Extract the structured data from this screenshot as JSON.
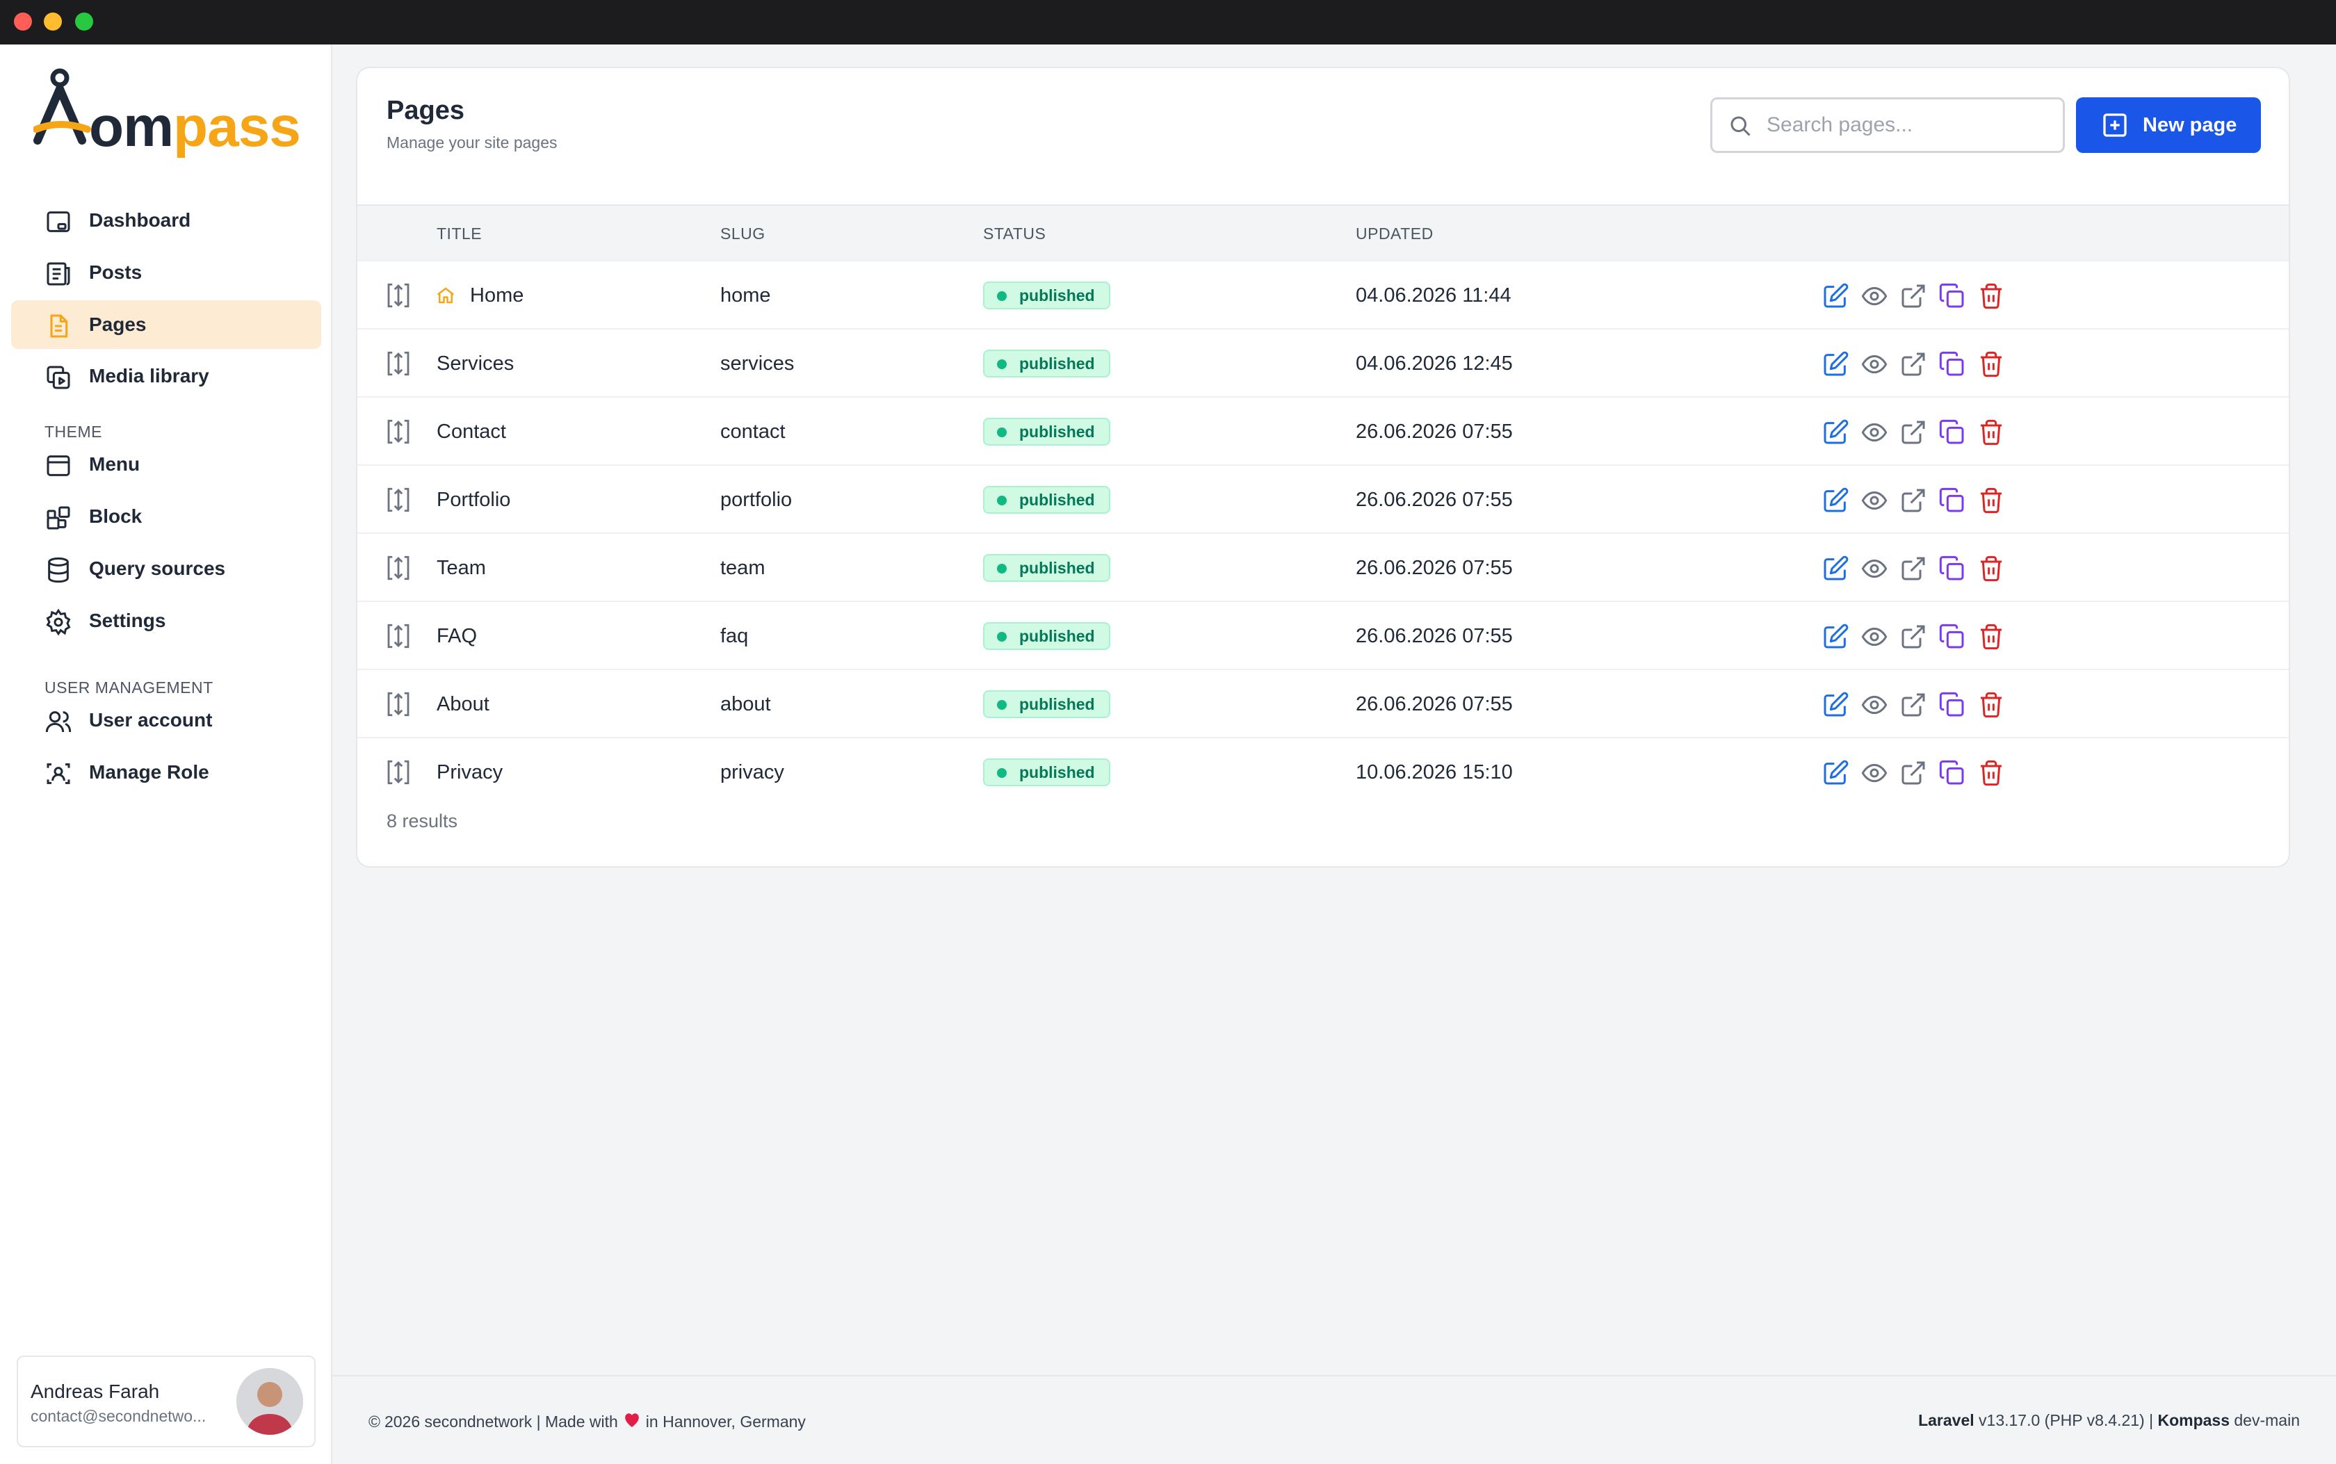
{
  "window": {
    "controls": [
      "close",
      "minimize",
      "maximize"
    ]
  },
  "brand": {
    "logo_k": "K",
    "logo_om": "om",
    "logo_pass": "pass",
    "accent": "#f5a516"
  },
  "sidebar": {
    "main_items": [
      {
        "label": "Dashboard",
        "icon": "dashboard-icon"
      },
      {
        "label": "Posts",
        "icon": "posts-icon"
      },
      {
        "label": "Pages",
        "icon": "pages-icon",
        "active": true
      },
      {
        "label": "Media library",
        "icon": "media-icon"
      }
    ],
    "theme_title": "THEME",
    "theme_items": [
      {
        "label": "Menu",
        "icon": "menu-icon"
      },
      {
        "label": "Block",
        "icon": "block-icon"
      },
      {
        "label": "Query sources",
        "icon": "database-icon"
      },
      {
        "label": "Settings",
        "icon": "gear-icon"
      }
    ],
    "user_mgmt_title": "USER MANAGEMENT",
    "user_items": [
      {
        "label": "User account",
        "icon": "users-icon"
      },
      {
        "label": "Manage Role",
        "icon": "role-icon"
      }
    ],
    "user": {
      "name": "Andreas Farah",
      "email": "contact@secondnetwork.de"
    }
  },
  "main": {
    "title": "Pages",
    "subtitle": "Manage your site pages",
    "search_placeholder": "Search pages...",
    "new_button": "New page",
    "columns": {
      "title": "TITLE",
      "slug": "SLUG",
      "status": "STATUS",
      "updated": "UPDATED"
    },
    "rows": [
      {
        "title": "Home",
        "slug": "home",
        "status": "published",
        "updated": "04.06.2026 11:44",
        "is_home": true
      },
      {
        "title": "Services",
        "slug": "services",
        "status": "published",
        "updated": "04.06.2026 12:45"
      },
      {
        "title": "Contact",
        "slug": "contact",
        "status": "published",
        "updated": "26.06.2026 07:55"
      },
      {
        "title": "Portfolio",
        "slug": "portfolio",
        "status": "published",
        "updated": "26.06.2026 07:55"
      },
      {
        "title": "Team",
        "slug": "team",
        "status": "published",
        "updated": "26.06.2026 07:55"
      },
      {
        "title": "FAQ",
        "slug": "faq",
        "status": "published",
        "updated": "26.06.2026 07:55"
      },
      {
        "title": "About",
        "slug": "about",
        "status": "published",
        "updated": "26.06.2026 07:55"
      },
      {
        "title": "Privacy",
        "slug": "privacy",
        "status": "published",
        "updated": "10.06.2026 15:10"
      }
    ],
    "results": "8 results",
    "row_actions": [
      "edit-icon",
      "eye-icon",
      "external-link-icon",
      "duplicate-icon",
      "trash-icon"
    ],
    "action_colors": {
      "edit": "#1d6fe0",
      "view": "#6b7280",
      "open": "#6b7280",
      "duplicate": "#7c3aed",
      "delete": "#dc2626"
    }
  },
  "footer": {
    "copyright": "2026 secondnetwork | Made with",
    "location": "in Hannover, Germany",
    "laravel_label": "Laravel",
    "laravel_version": "v13.17.0 (PHP v8.4.21) |",
    "kompass_label": "Kompass",
    "kompass_version": "dev-main"
  }
}
